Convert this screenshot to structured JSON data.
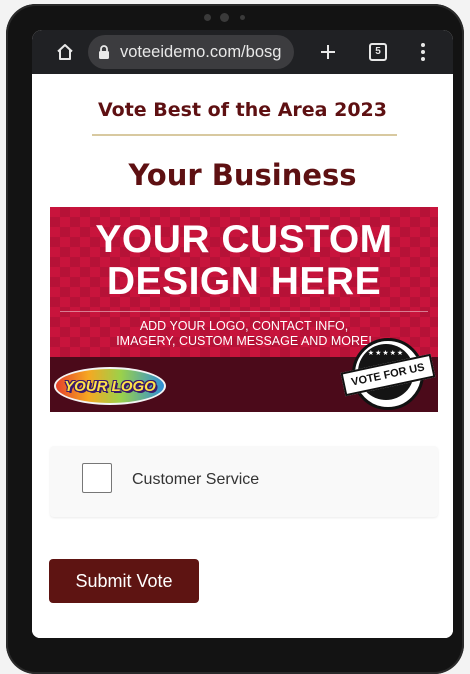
{
  "browser": {
    "url": "voteeidemo.com/bosg",
    "tab_count": "5",
    "icons": {
      "home": "home-icon",
      "lock": "lock-icon",
      "new_tab": "plus-icon",
      "tabs": "tab-switcher-icon",
      "menu": "more-vertical-icon"
    }
  },
  "page": {
    "contest_title": "Vote Best of the Area 2023",
    "business_name": "Your Business",
    "banner": {
      "headline": "YOUR CUSTOM\nDESIGN HERE",
      "subtext": "ADD YOUR LOGO, CONTACT INFO,\nIMAGERY, CUSTOM MESSAGE AND MORE!",
      "logo_text": "YOUR LOGO",
      "seal_text": "VOTE FOR US",
      "seal_stars": "★★★★★"
    },
    "categories": [
      {
        "label": "Customer Service",
        "checked": false
      }
    ],
    "submit_label": "Submit Vote"
  },
  "colors": {
    "brand_maroon": "#5e1012",
    "banner_red": "#c8143c",
    "divider_gold": "#d8c9a0",
    "browser_bar": "#202124"
  }
}
